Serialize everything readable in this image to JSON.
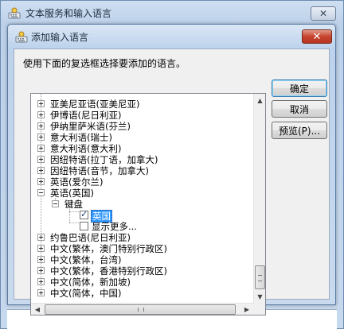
{
  "outer_window": {
    "title": "文本服务和输入语言",
    "close_glyph": "✕"
  },
  "dialog": {
    "title": "添加输入语言",
    "close_glyph": "✕",
    "instruction": "使用下面的复选框选择要添加的语言。",
    "buttons": {
      "ok": "确定",
      "cancel": "取消",
      "preview": "预览(P)..."
    }
  },
  "tree": {
    "languages": [
      "亚美尼亚语(亚美尼亚)",
      "伊博语(尼日利亚)",
      "伊纳里萨米语(芬兰)",
      "意大利语(瑞士)",
      "意大利语(意大利)",
      "因纽特语(拉丁语，加拿大)",
      "因纽特语(音节，加拿大)",
      "英语(爱尔兰)",
      "英语(英国)"
    ],
    "keyboard_group": "键盘",
    "keyboard_item": {
      "label": "英国",
      "checked": true
    },
    "show_more": "显示更多...",
    "languages_after": [
      "约鲁巴语(尼日利亚)",
      "中文(繁体，澳门特别行政区)",
      "中文(繁体，台湾)",
      "中文(繁体，香港特别行政区)",
      "中文(简体，新加坡)",
      "中文(简体，中国)"
    ]
  },
  "colors": {
    "selection": "#3399ff",
    "dialog_close": "#c5432f"
  }
}
